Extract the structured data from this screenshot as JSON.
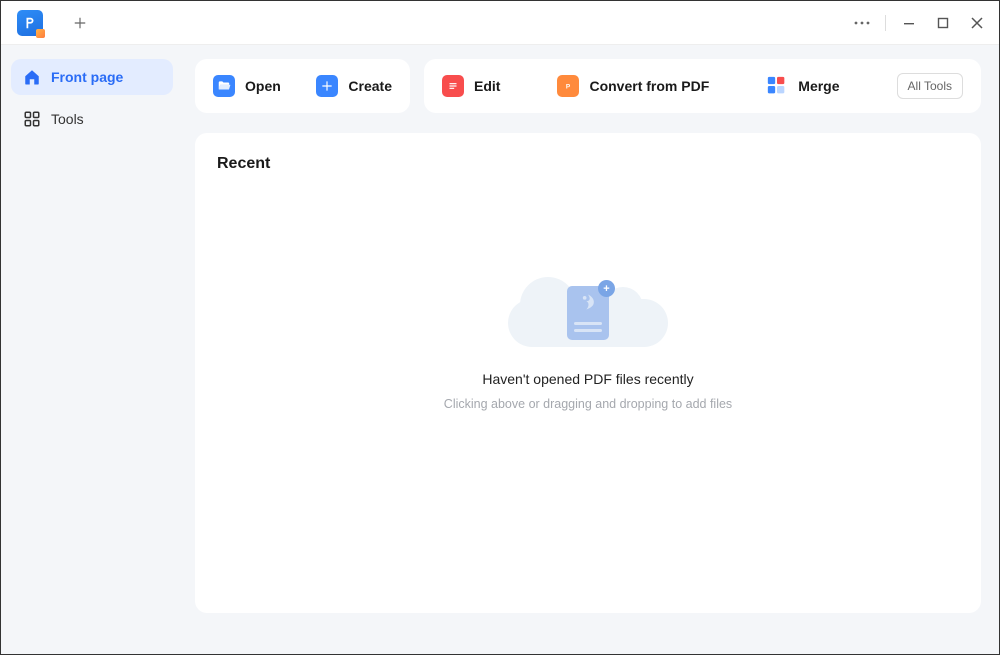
{
  "titlebar": {
    "new_tab_tooltip": "New Tab"
  },
  "sidebar": {
    "items": [
      {
        "id": "front-page",
        "label": "Front page",
        "active": true
      },
      {
        "id": "tools",
        "label": "Tools",
        "active": false
      }
    ]
  },
  "toolbar": {
    "open_label": "Open",
    "create_label": "Create",
    "edit_label": "Edit",
    "convert_label": "Convert from PDF",
    "merge_label": "Merge",
    "all_tools_label": "All Tools"
  },
  "recent": {
    "heading": "Recent",
    "empty_title": "Haven't opened PDF files recently",
    "empty_sub": "Clicking above or dragging and dropping to add files"
  }
}
